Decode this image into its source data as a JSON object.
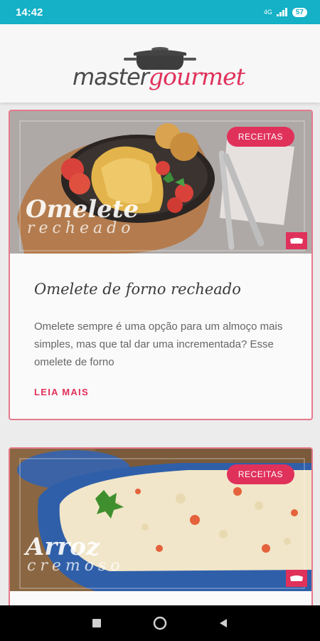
{
  "status_bar": {
    "time": "14:42",
    "network": "4G",
    "battery": "57"
  },
  "header": {
    "logo_master": "master",
    "logo_gourmet": "gourmet"
  },
  "cards": [
    {
      "badge": "RECEITAS",
      "overlay_title": "Omelete",
      "overlay_subtitle": "recheado",
      "title": "Omelete de forno recheado",
      "excerpt": "Omelete sempre é uma opção para um almoço mais simples, mas que tal dar uma incrementada? Esse omelete de forno",
      "read_more": "LEIA MAIS"
    },
    {
      "badge": "RECEITAS",
      "overlay_title": "Arroz",
      "overlay_subtitle": "cremoso"
    }
  ],
  "colors": {
    "accent": "#e0315b",
    "status_bar": "#14b1c7",
    "card_border": "#e57a8c"
  },
  "icons": {
    "back": "triangle-left",
    "home": "circle",
    "recents": "square"
  }
}
